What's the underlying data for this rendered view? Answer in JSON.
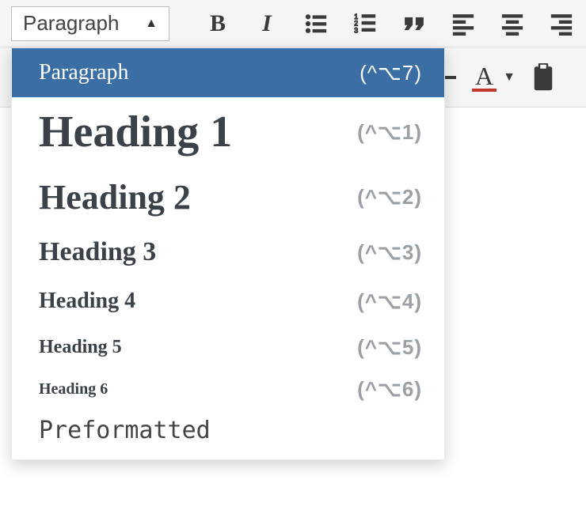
{
  "format_select": {
    "current": "Paragraph"
  },
  "dropdown": {
    "items": [
      {
        "label": "Paragraph",
        "shortcut": "(^⌥7)",
        "cls": "dd-paragraph",
        "selected": true
      },
      {
        "label": "Heading 1",
        "shortcut": "(^⌥1)",
        "cls": "dd-h1",
        "selected": false
      },
      {
        "label": "Heading 2",
        "shortcut": "(^⌥2)",
        "cls": "dd-h2",
        "selected": false
      },
      {
        "label": "Heading 3",
        "shortcut": "(^⌥3)",
        "cls": "dd-h3",
        "selected": false
      },
      {
        "label": "Heading 4",
        "shortcut": "(^⌥4)",
        "cls": "dd-h4",
        "selected": false
      },
      {
        "label": "Heading 5",
        "shortcut": "(^⌥5)",
        "cls": "dd-h5",
        "selected": false
      },
      {
        "label": "Heading 6",
        "shortcut": "(^⌥6)",
        "cls": "dd-h6",
        "selected": false
      },
      {
        "label": "Preformatted",
        "shortcut": "",
        "cls": "dd-pre",
        "selected": false
      }
    ]
  },
  "toolbar": {
    "bold": "B",
    "italic": "I"
  },
  "textcolor": {
    "letter": "A",
    "underline_color": "#c0392b"
  }
}
